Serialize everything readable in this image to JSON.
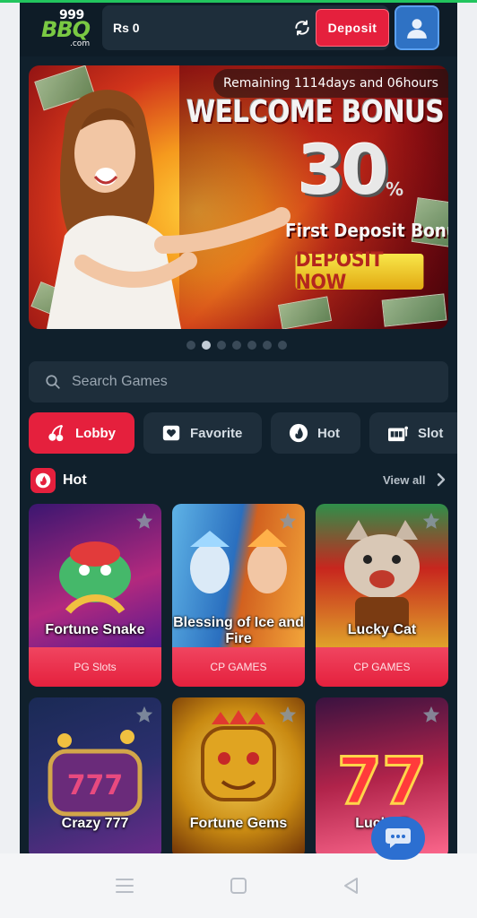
{
  "header": {
    "logo_top": "999",
    "logo_main": "BBQ",
    "logo_sub": ".com",
    "balance": "Rs 0",
    "deposit_label": "Deposit"
  },
  "banner": {
    "remaining": "Remaining 1114days and 06hours",
    "title": "WELCOME BONUS",
    "percent": "30",
    "percent_sign": "%",
    "subtitle": "First Deposit Bonus",
    "cta": "DEPOSIT NOW",
    "slide_count": 7,
    "active_slide": 2
  },
  "search": {
    "placeholder": "Search Games"
  },
  "tabs": [
    {
      "label": "Lobby",
      "icon": "cherry-icon",
      "active": true
    },
    {
      "label": "Favorite",
      "icon": "heart-box-icon",
      "active": false
    },
    {
      "label": "Hot",
      "icon": "flame-icon",
      "active": false
    },
    {
      "label": "Slot",
      "icon": "slot-machine-icon",
      "active": false
    }
  ],
  "hot_section": {
    "title": "Hot",
    "view_all": "View all",
    "games": [
      {
        "name": "Fortune Snake",
        "provider": "PG Slots",
        "colors": [
          "#6a1fa8",
          "#e43b8f"
        ]
      },
      {
        "name": "Blessing of Ice and Fire",
        "provider": "CP GAMES",
        "colors": [
          "#2a6fbf",
          "#d2611f"
        ]
      },
      {
        "name": "Lucky Cat",
        "provider": "CP GAMES",
        "colors": [
          "#2f8f4a",
          "#d99a2a"
        ]
      },
      {
        "name": "Crazy 777",
        "provider": "",
        "colors": [
          "#1d2e6b",
          "#7a2a8f"
        ]
      },
      {
        "name": "Fortune Gems",
        "provider": "",
        "colors": [
          "#c98a12",
          "#7a3a0a"
        ]
      },
      {
        "name": "Lucky 7",
        "provider": "",
        "colors": [
          "#b0234a",
          "#e23b6b"
        ]
      }
    ]
  },
  "colors": {
    "accent": "#e5203d",
    "background": "#10202c",
    "surface": "#1e2e3b",
    "profile": "#2f72c4"
  }
}
